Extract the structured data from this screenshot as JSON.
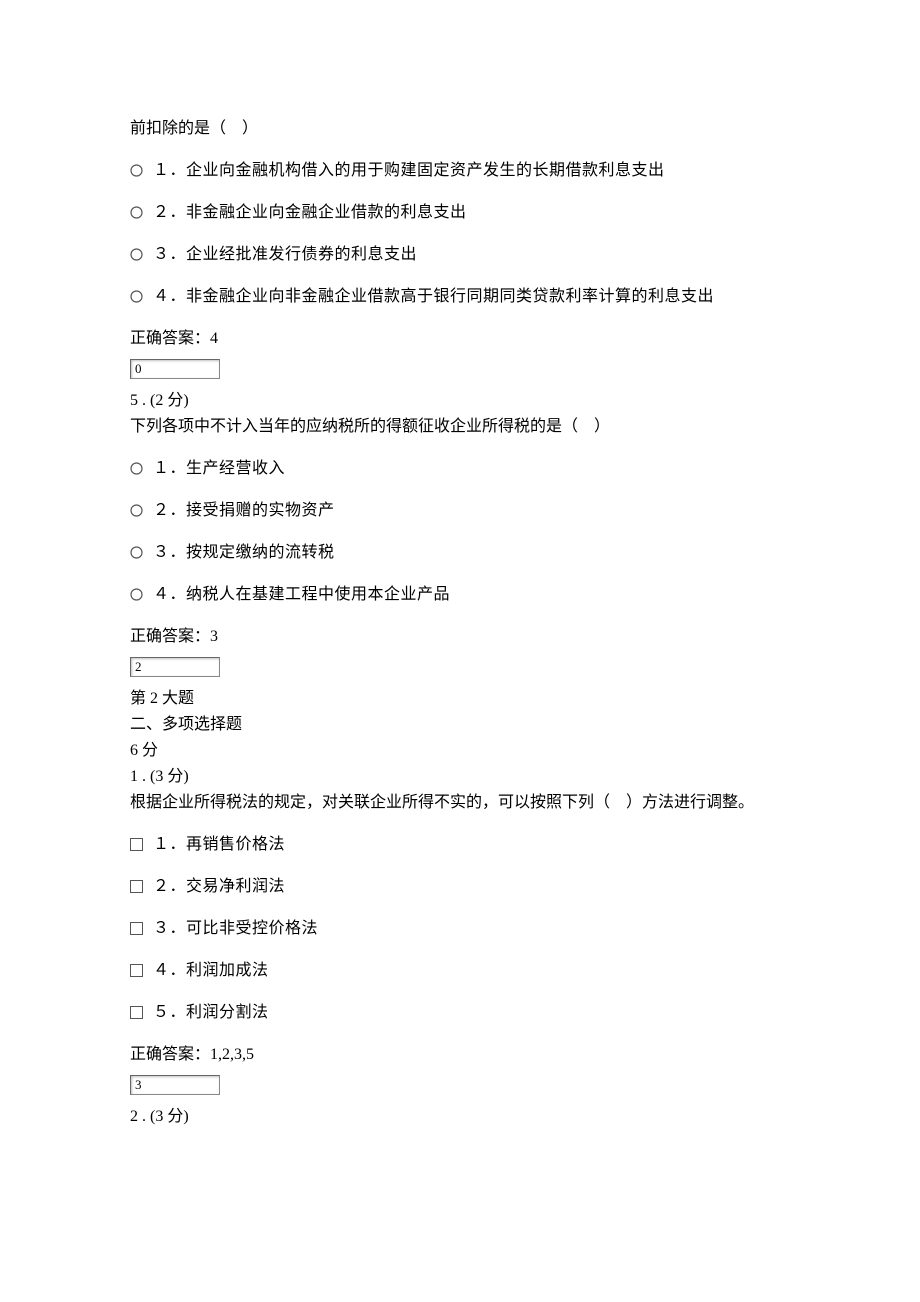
{
  "q4": {
    "stem": "前扣除的是（　）",
    "options": [
      "１．企业向金融机构借入的用于购建固定资产发生的长期借款利息支出",
      "２．非金融企业向金融企业借款的利息支出",
      "３．企业经批准发行债券的利息支出",
      "４．非金融企业向非金融企业借款高于银行同期同类贷款利率计算的利息支出"
    ],
    "answer_label": "正确答案：4",
    "input_value": "0"
  },
  "q5": {
    "header": "5 . (2 分)",
    "stem": "下列各项中不计入当年的应纳税所的得额征收企业所得税的是（　）",
    "options": [
      "１．生产经营收入",
      "２．接受捐赠的实物资产",
      "３．按规定缴纳的流转税",
      "４．纳税人在基建工程中使用本企业产品"
    ],
    "answer_label": "正确答案：3",
    "input_value": "2"
  },
  "section2": {
    "title1": "第 2 大题",
    "title2": "二、多项选择题",
    "points": "6 分"
  },
  "q_s2_1": {
    "header": "1 . (3 分)",
    "stem": "根据企业所得税法的规定，对关联企业所得不实的，可以按照下列（　）方法进行调整。",
    "options": [
      "１．再销售价格法",
      "２．交易净利润法",
      "３．可比非受控价格法",
      "４．利润加成法",
      "５．利润分割法"
    ],
    "answer_label": "正确答案：1,2,3,5",
    "input_value": "3"
  },
  "q_s2_2": {
    "header": "2 . (3 分)"
  }
}
